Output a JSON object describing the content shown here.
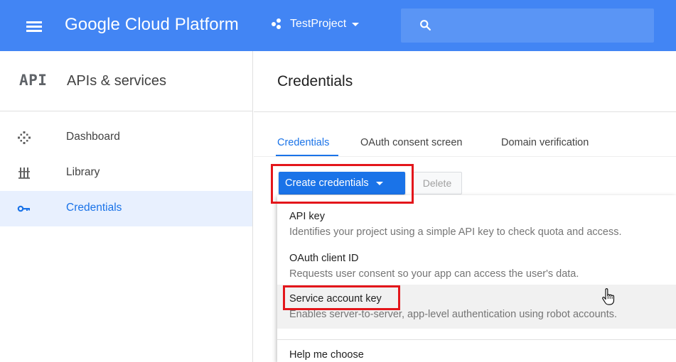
{
  "topbar": {
    "brand": "Google Cloud Platform",
    "project_name": "TestProject",
    "accent_color": "#4285f4",
    "icons": [
      "menu-icon",
      "project-dots-icon",
      "dropdown-caret-icon",
      "search-icon"
    ]
  },
  "sidebar": {
    "logo": "API",
    "title": "APIs & services",
    "items": [
      {
        "label": "Dashboard",
        "icon": "dashboard-icon"
      },
      {
        "label": "Library",
        "icon": "library-icon"
      },
      {
        "label": "Credentials",
        "icon": "key-icon",
        "active": true
      }
    ]
  },
  "main": {
    "title": "Credentials",
    "tabs": [
      {
        "label": "Credentials",
        "active": true
      },
      {
        "label": "OAuth consent screen"
      },
      {
        "label": "Domain verification"
      }
    ],
    "toolbar": {
      "create_label": "Create credentials",
      "delete_label": "Delete"
    },
    "menu": {
      "items": [
        {
          "title": "API key",
          "description": "Identifies your project using a simple API key to check quota and access."
        },
        {
          "title": "OAuth client ID",
          "description": "Requests user consent so your app can access the user's data."
        },
        {
          "title": "Service account key",
          "description": "Enables server-to-server, app-level authentication using robot accounts.",
          "hovered": true
        }
      ],
      "help_label": "Help me choose"
    }
  },
  "annotation_color": "#e3161b"
}
